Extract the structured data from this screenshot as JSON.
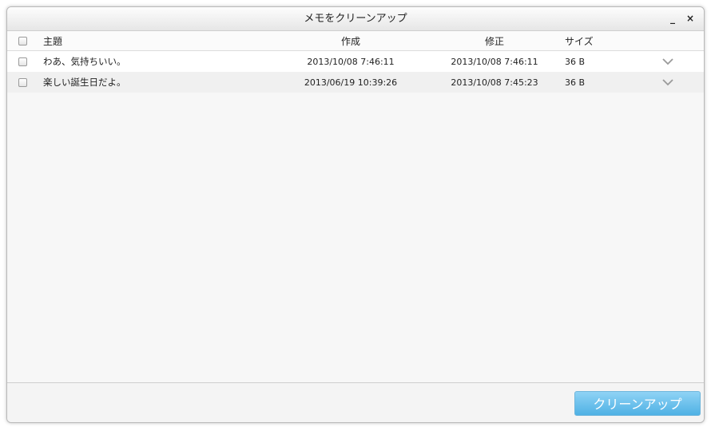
{
  "window": {
    "title": "メモをクリーンアップ",
    "minimize_glyph": "_",
    "close_glyph": "×"
  },
  "table": {
    "columns": {
      "subject": "主題",
      "created": "作成",
      "modified": "修正",
      "size": "サイズ"
    },
    "rows": [
      {
        "subject": "わあ、気持ちいい。",
        "created": "2013/10/08 7:46:11",
        "modified": "2013/10/08 7:46:11",
        "size": "36 B",
        "checked": false
      },
      {
        "subject": "楽しい誕生日だよ。",
        "created": "2013/06/19 10:39:26",
        "modified": "2013/10/08 7:45:23",
        "size": "36 B",
        "checked": false
      }
    ]
  },
  "footer": {
    "cleanup_label": "クリーンアップ"
  },
  "colors": {
    "accent": "#4fb1e4",
    "window_bg": "#f7f7f7"
  }
}
